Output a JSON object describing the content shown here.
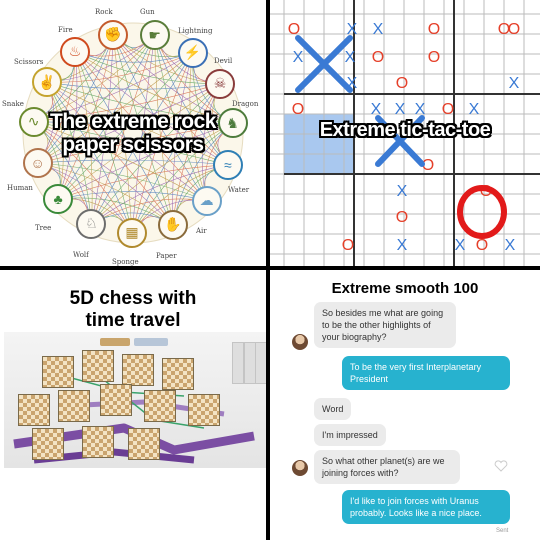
{
  "rps": {
    "caption_line1": "The extreme rock",
    "caption_line2": "paper scissors",
    "nodes": {
      "rock": "Rock",
      "gun": "Gun",
      "lightning": "Lightning",
      "devil": "Devil",
      "dragon": "Dragon",
      "water": "Water",
      "air": "Air",
      "paper": "Paper",
      "sponge": "Sponge",
      "wolf": "Wolf",
      "tree": "Tree",
      "human": "Human",
      "snake": "Snake",
      "scissors": "Scissors",
      "fire": "Fire"
    }
  },
  "ttt": {
    "caption": "Extreme tic-tac-toe",
    "x_mark": "X",
    "o_mark": "O"
  },
  "chess": {
    "title_line1": "5D chess with",
    "title_line2": "time travel"
  },
  "chat": {
    "title": "Extreme smooth 100",
    "messages": [
      {
        "from": "them",
        "text": "So besides me what are going to be the other highlights of your biography?"
      },
      {
        "from": "me",
        "text": "To be the very first Interplanetary President"
      },
      {
        "from": "them",
        "text": "Word"
      },
      {
        "from": "them",
        "text": "I'm impressed"
      },
      {
        "from": "them",
        "text": "So what other planet(s) are we joining forces with?"
      },
      {
        "from": "me",
        "text": "I'd like to join forces with Uranus probably. Looks like a nice place."
      }
    ],
    "sent_label": "Sent"
  }
}
